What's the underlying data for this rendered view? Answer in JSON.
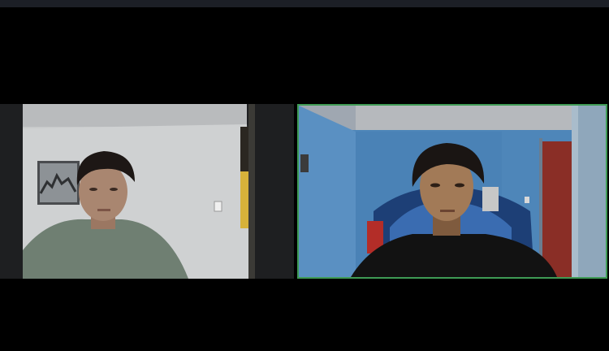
{
  "app": {
    "title": "",
    "active_speaker_color": "#3f9b55"
  },
  "participants": [
    {
      "name": "",
      "active_speaker": false,
      "video": "on"
    },
    {
      "name": "",
      "active_speaker": true,
      "video": "on"
    }
  ]
}
